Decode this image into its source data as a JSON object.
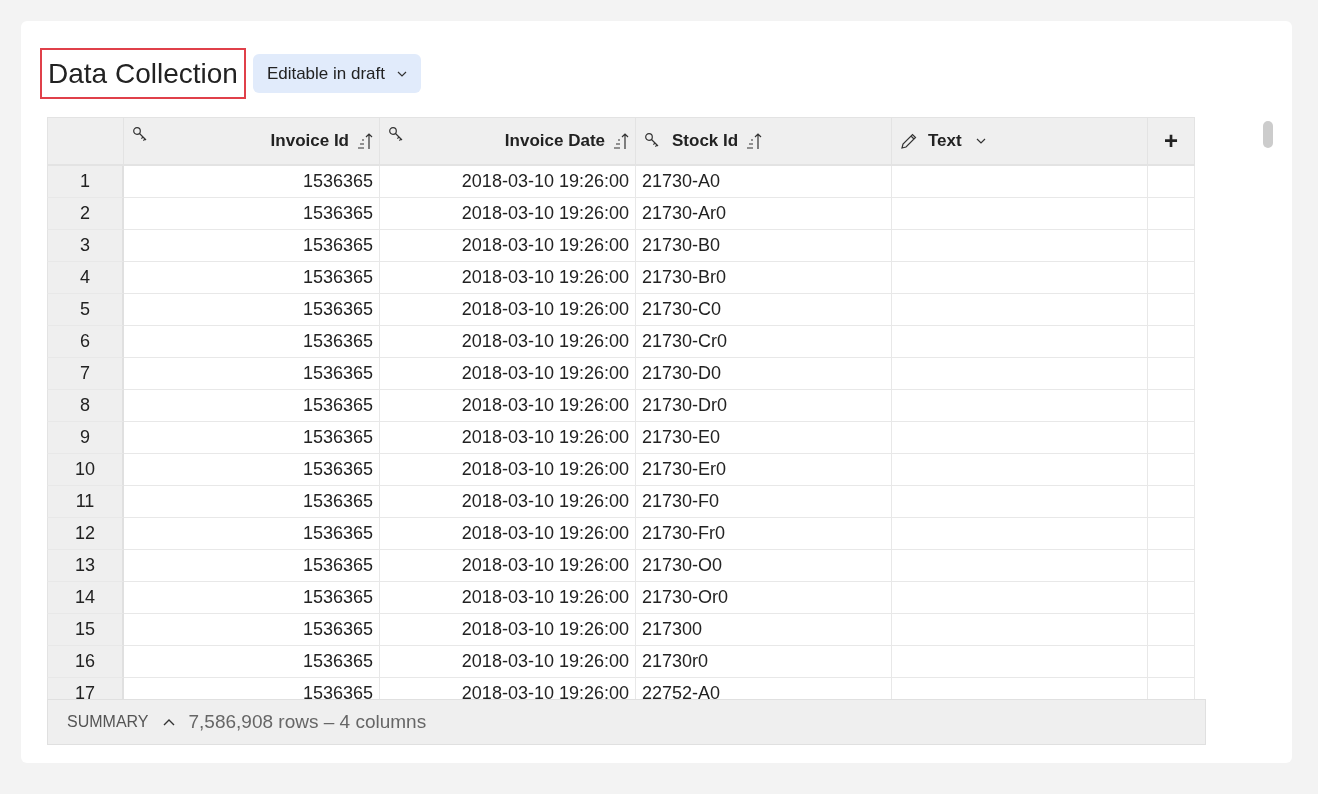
{
  "title": "Data Collection",
  "mode_badge": {
    "label": "Editable in draft"
  },
  "table": {
    "columns": [
      {
        "label": "Invoice Id",
        "kind": "key",
        "right_aligned": true,
        "sorted": true
      },
      {
        "label": "Invoice Date",
        "kind": "key",
        "right_aligned": true,
        "sorted": true
      },
      {
        "label": "Stock Id",
        "kind": "key",
        "right_aligned": false,
        "sorted": true
      },
      {
        "label": "Text",
        "kind": "editable",
        "right_aligned": false,
        "sorted": false
      }
    ],
    "add_column": "+",
    "rows": [
      {
        "n": "1",
        "cells": [
          "1536365",
          "2018-03-10 19:26:00",
          "21730-A0"
        ]
      },
      {
        "n": "2",
        "cells": [
          "1536365",
          "2018-03-10 19:26:00",
          "21730-Ar0"
        ]
      },
      {
        "n": "3",
        "cells": [
          "1536365",
          "2018-03-10 19:26:00",
          "21730-B0"
        ]
      },
      {
        "n": "4",
        "cells": [
          "1536365",
          "2018-03-10 19:26:00",
          "21730-Br0"
        ]
      },
      {
        "n": "5",
        "cells": [
          "1536365",
          "2018-03-10 19:26:00",
          "21730-C0"
        ]
      },
      {
        "n": "6",
        "cells": [
          "1536365",
          "2018-03-10 19:26:00",
          "21730-Cr0"
        ]
      },
      {
        "n": "7",
        "cells": [
          "1536365",
          "2018-03-10 19:26:00",
          "21730-D0"
        ]
      },
      {
        "n": "8",
        "cells": [
          "1536365",
          "2018-03-10 19:26:00",
          "21730-Dr0"
        ]
      },
      {
        "n": "9",
        "cells": [
          "1536365",
          "2018-03-10 19:26:00",
          "21730-E0"
        ]
      },
      {
        "n": "10",
        "cells": [
          "1536365",
          "2018-03-10 19:26:00",
          "21730-Er0"
        ]
      },
      {
        "n": "11",
        "cells": [
          "1536365",
          "2018-03-10 19:26:00",
          "21730-F0"
        ]
      },
      {
        "n": "12",
        "cells": [
          "1536365",
          "2018-03-10 19:26:00",
          "21730-Fr0"
        ]
      },
      {
        "n": "13",
        "cells": [
          "1536365",
          "2018-03-10 19:26:00",
          "21730-O0"
        ]
      },
      {
        "n": "14",
        "cells": [
          "1536365",
          "2018-03-10 19:26:00",
          "21730-Or0"
        ]
      },
      {
        "n": "15",
        "cells": [
          "1536365",
          "2018-03-10 19:26:00",
          "217300"
        ]
      },
      {
        "n": "16",
        "cells": [
          "1536365",
          "2018-03-10 19:26:00",
          "21730r0"
        ]
      },
      {
        "n": "17",
        "cells": [
          "1536365",
          "2018-03-10 19:26:00",
          "22752-A0"
        ]
      }
    ]
  },
  "summary": {
    "label": "SUMMARY",
    "expanded": false,
    "counts": "7,586,908 rows – 4 columns"
  }
}
